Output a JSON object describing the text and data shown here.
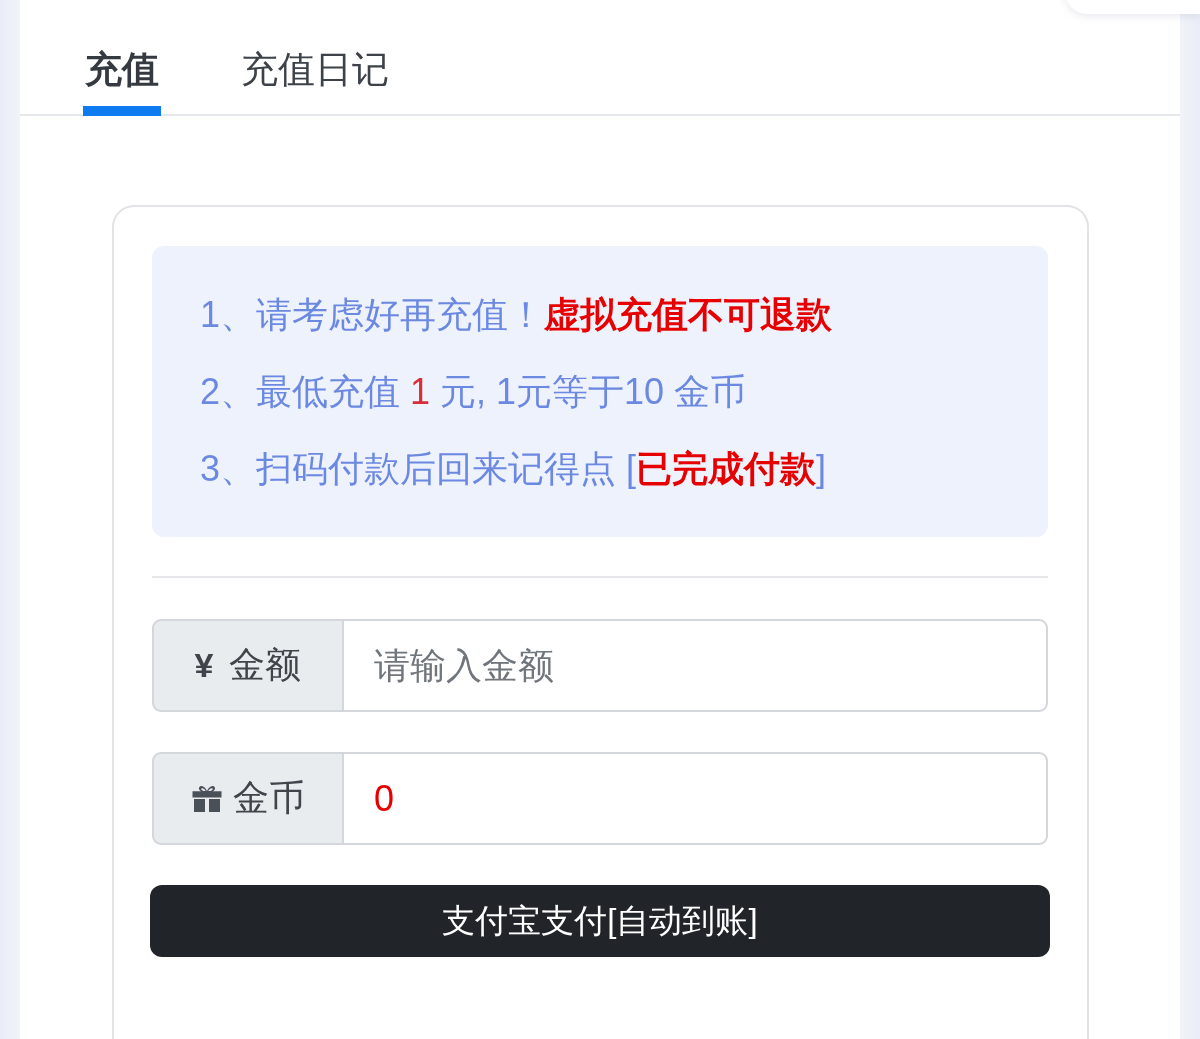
{
  "tabs": [
    {
      "label": "充值",
      "selected": true
    },
    {
      "label": "充值日记",
      "selected": false
    }
  ],
  "notice": {
    "lines": [
      {
        "segments": [
          {
            "text": "1、请考虑好再充值！",
            "kind": "plain"
          },
          {
            "text": "虚拟充值不可退款",
            "kind": "warning"
          }
        ]
      },
      {
        "segments": [
          {
            "text": "2、最低充值 ",
            "kind": "plain"
          },
          {
            "text": "1",
            "kind": "highlight"
          },
          {
            "text": " 元, 1元等于10 金币",
            "kind": "plain"
          }
        ]
      },
      {
        "segments": [
          {
            "text": "3、扫码付款后回来记得点 [",
            "kind": "plain"
          },
          {
            "text": "已完成付款",
            "kind": "warning"
          },
          {
            "text": "]",
            "kind": "plain"
          }
        ]
      }
    ]
  },
  "fields": [
    {
      "kind": "amount",
      "symbol": "¥",
      "label": "金额",
      "placeholder": "请输入金额"
    },
    {
      "kind": "coins",
      "label": "金币",
      "value": "0"
    }
  ],
  "pay_button": {
    "label": "支付宝支付[自动到账]"
  }
}
